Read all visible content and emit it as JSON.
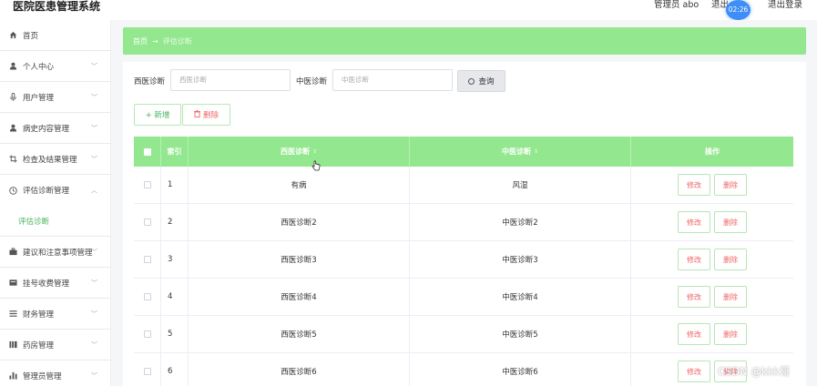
{
  "header": {
    "title": "医院医患管理系统",
    "user_info": "管理员 abo",
    "exit_system": "退出",
    "logout": "退出登录",
    "time_badge": "02:26"
  },
  "sidebar": {
    "items": [
      {
        "label": "首页",
        "icon": "home-icon"
      },
      {
        "label": "个人中心",
        "icon": "user-icon"
      },
      {
        "label": "用户管理",
        "icon": "microphone-icon"
      },
      {
        "label": "病史内容管理",
        "icon": "user-icon"
      },
      {
        "label": "检查及结果管理",
        "icon": "crop-icon"
      },
      {
        "label": "评估诊断管理",
        "icon": "clock-icon"
      },
      {
        "label": "评估诊断",
        "icon": ""
      },
      {
        "label": "建议和注意事项管理",
        "icon": "briefcase-icon"
      },
      {
        "label": "挂号收费管理",
        "icon": "card-icon"
      },
      {
        "label": "财务管理",
        "icon": "list-icon"
      },
      {
        "label": "药房管理",
        "icon": "bars-icon"
      },
      {
        "label": "管理员管理",
        "icon": "chart-icon"
      }
    ]
  },
  "breadcrumb": {
    "home": "首页",
    "arrow": "→",
    "current": "评估诊断"
  },
  "search": {
    "west_label": "西医诊断",
    "west_placeholder": "西医诊断",
    "chinese_label": "中医诊断",
    "chinese_placeholder": "中医诊断",
    "search_button": "查询"
  },
  "actions": {
    "add_label": "+ 新增",
    "delete_label": "删除"
  },
  "table": {
    "columns": {
      "index": "索引",
      "west": "西医诊断",
      "chinese": "中医诊断",
      "operation": "操作"
    },
    "edit_label": "修改",
    "delete_label": "删除",
    "rows": [
      {
        "index": "1",
        "west": "有病",
        "chinese": "风湿"
      },
      {
        "index": "2",
        "west": "西医诊断2",
        "chinese": "中医诊断2"
      },
      {
        "index": "3",
        "west": "西医诊断3",
        "chinese": "中医诊断3"
      },
      {
        "index": "4",
        "west": "西医诊断4",
        "chinese": "中医诊断4"
      },
      {
        "index": "5",
        "west": "西医诊断5",
        "chinese": "中医诊断5"
      },
      {
        "index": "6",
        "west": "西医诊断6",
        "chinese": "中医诊断6"
      }
    ]
  },
  "watermark": "CSDN @kkk哥",
  "colors": {
    "accent_green": "#93e88f",
    "link_green": "#46b45a",
    "danger_red": "#e66",
    "badge_blue": "#3e8ef7"
  }
}
